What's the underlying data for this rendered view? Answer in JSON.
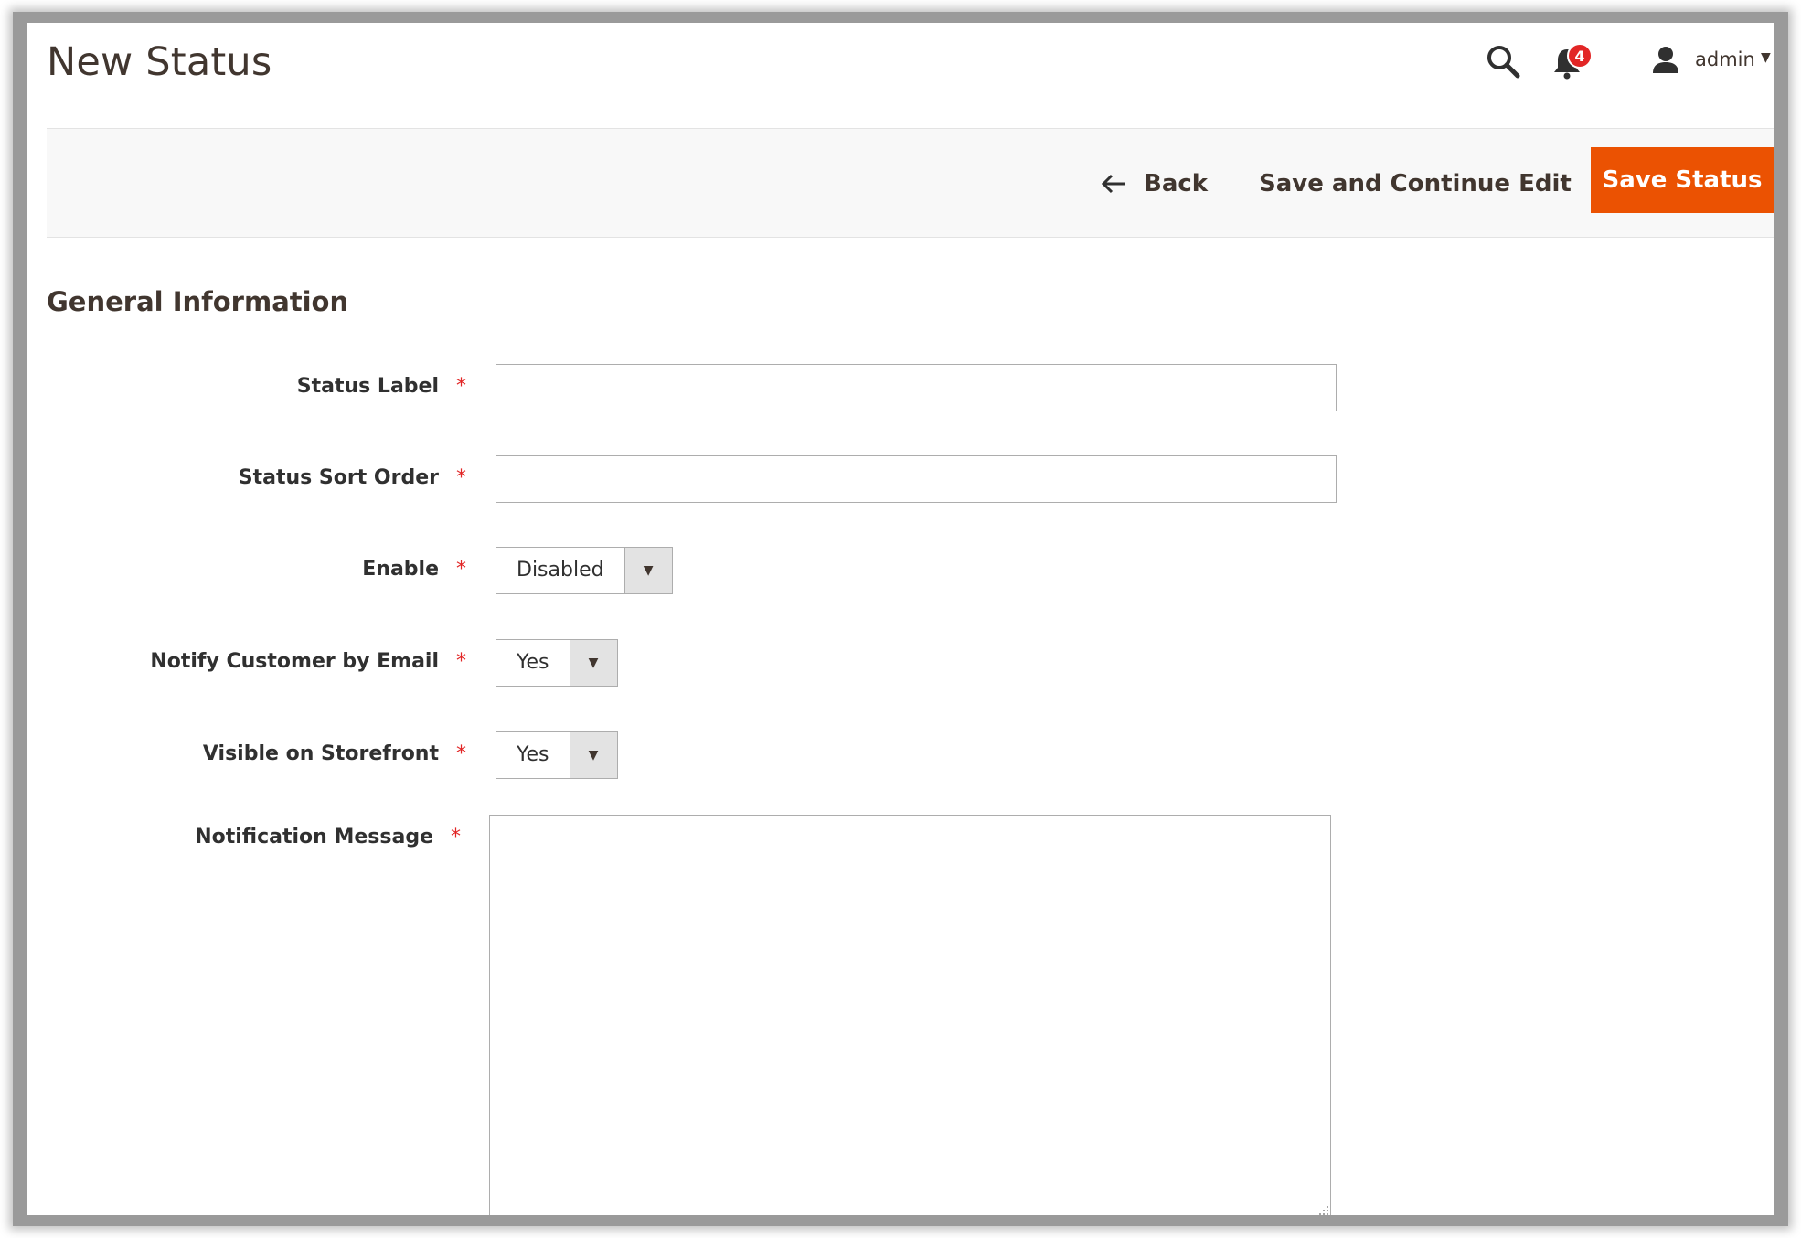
{
  "header": {
    "title": "New Status",
    "notifications_count": "4",
    "user_name": "admin",
    "caret": "▼"
  },
  "actions": {
    "back_label": "Back",
    "save_continue_label": "Save and Continue Edit",
    "save_label": "Save Status"
  },
  "section": {
    "title": "General Information"
  },
  "form": {
    "required_mark": "*",
    "status_label": {
      "label": "Status Label",
      "value": ""
    },
    "status_sort_order": {
      "label": "Status Sort Order",
      "value": ""
    },
    "enable": {
      "label": "Enable",
      "value": "Disabled"
    },
    "notify_customer": {
      "label": "Notify Customer by Email",
      "value": "Yes"
    },
    "visible_storefront": {
      "label": "Visible on Storefront",
      "value": "Yes"
    },
    "notification_message": {
      "label": "Notification Message",
      "value": ""
    },
    "select_caret": "▼"
  },
  "colors": {
    "accent": "#eb5202",
    "badge": "#e22626",
    "required": "#e22626",
    "action_bar_bg": "#f8f8f8"
  }
}
